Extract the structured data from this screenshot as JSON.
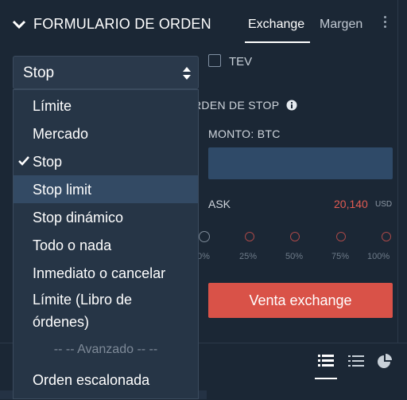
{
  "header": {
    "title": "FORMULARIO DE ORDEN",
    "tabs": [
      {
        "label": "Exchange",
        "active": true
      },
      {
        "label": "Margen",
        "active": false
      }
    ]
  },
  "order_type": {
    "selected": "Stop",
    "options": [
      {
        "label": "Límite"
      },
      {
        "label": "Mercado"
      },
      {
        "label": "Stop",
        "checked": true
      },
      {
        "label": "Stop limit",
        "highlighted": true
      },
      {
        "label": "Stop dinámico"
      },
      {
        "label": "Todo o nada"
      },
      {
        "label": "Inmediato o cancelar"
      },
      {
        "label_line1": "Límite (Libro de",
        "label_line2": "órdenes)"
      },
      {
        "label": "Orden escalonada"
      }
    ],
    "group_label": "-- -- Avanzado -- --"
  },
  "tev": {
    "label": "TEV",
    "checked": false
  },
  "form": {
    "heading": "RDEN DE STOP",
    "amount_label": "MONTO: BTC",
    "amount_value": "",
    "ask_label": "ASK",
    "ask_value": "20,140",
    "ask_unit": "USD",
    "percent_marks": [
      "0%",
      "25%",
      "50%",
      "75%",
      "100%"
    ],
    "sell_button": "Venta exchange"
  },
  "colors": {
    "background": "#1b2735",
    "accent_red": "#d95248",
    "input_blue": "#2f4a68",
    "highlight": "#334a64"
  },
  "icons": [
    "chevron-down-icon",
    "kebab-menu-icon",
    "select-arrows-icon",
    "checkmark-icon",
    "info-icon",
    "list-view-icon",
    "compact-list-icon",
    "pie-chart-icon"
  ]
}
